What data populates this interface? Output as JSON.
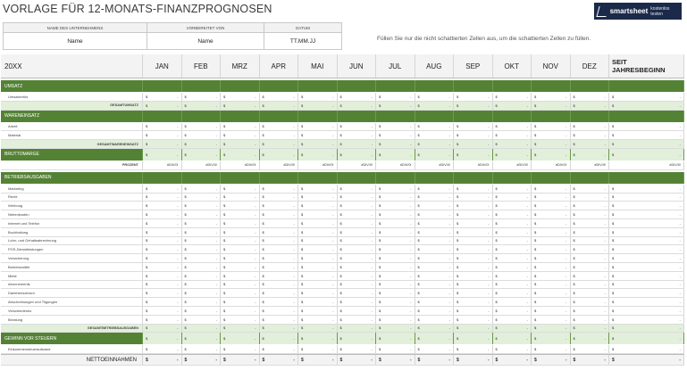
{
  "title": "VORLAGE FÜR 12-MONATS-FINANZPROGNOSEN",
  "logo": {
    "brand": "smartsheet",
    "cta": "kostenlos testen"
  },
  "info": {
    "headers": [
      "NAME DES UNTERNEHMENS",
      "VORBEREITET VON",
      "DATUM"
    ],
    "values": [
      "Name",
      "Name",
      "TT.MM.JJ"
    ]
  },
  "hint": "Füllen Sie nur die nicht schattierten Zellen aus, um die schattierten Zellen zu füllen.",
  "year_label": "20XX",
  "months": [
    "JAN",
    "FEB",
    "MRZ",
    "APR",
    "MAI",
    "JUN",
    "JUL",
    "AUG",
    "SEP",
    "OKT",
    "NOV",
    "DEZ"
  ],
  "ytd_label": "SEIT JAHRESBEGINN",
  "currency": "$",
  "dash": "-",
  "div": "#DIV/0!",
  "sections": {
    "umsatz": {
      "label": "UMSATZ",
      "items": [
        "Umsatzerlös"
      ],
      "total": "GESAMTUMSATZ"
    },
    "wareneinsatz": {
      "label": "WARENEINSATZ",
      "items": [
        "Arbeit",
        "Material"
      ],
      "total": "GESAMTWARENEINSATZ"
    },
    "brutto": {
      "label": "BRUTTOMARGE",
      "pct_label": "PROZENT"
    },
    "betrieb": {
      "label": "BETRIEBSAUSGABEN",
      "items": [
        "Marketing",
        "Recht",
        "Werbung",
        "Nebenkosten",
        "Internet und Telefon",
        "Buchhaltung",
        "Lohn- und Gehaltsabrechnung",
        "POS-Dienstleistungen",
        "Versicherung",
        "Betriebsmittel",
        "Miete",
        "Abonnements",
        "Darlehenszinsen",
        "Abschreibungen und Tilgungen",
        "Verschiedenes",
        "Beratung"
      ],
      "total": "GESAMTBETRIEBSAUSGABEN"
    },
    "gewinn": {
      "label": "GEWINN VOR STEUERN",
      "items": [
        "Einkommensteueraufwand"
      ]
    },
    "netto": "NETTOEINNAHMEN"
  }
}
